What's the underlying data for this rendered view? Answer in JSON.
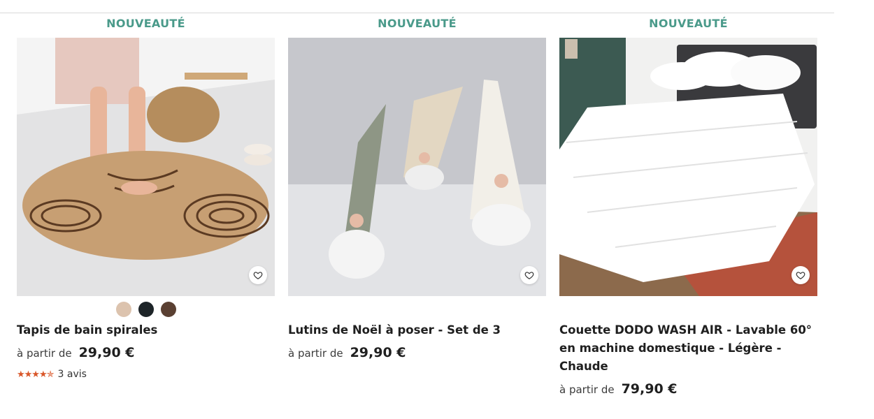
{
  "products": [
    {
      "badge": "NOUVEAUTÉ",
      "title": "Tapis de bain spirales",
      "from_label": "à partir de",
      "price": "29,90 €",
      "swatches": [
        "#dcc3ae",
        "#1d2428",
        "#5a4032"
      ],
      "rating": {
        "stars": 4.5,
        "star_glyphs": "★★★★✯",
        "reviews": "3 avis"
      },
      "wishlist_icon": "heart-outline-icon"
    },
    {
      "badge": "NOUVEAUTÉ",
      "title": "Lutins de Noël à poser - Set de 3",
      "from_label": "à partir de",
      "price": "29,90 €",
      "wishlist_icon": "heart-outline-icon"
    },
    {
      "badge": "NOUVEAUTÉ",
      "title": "Couette DODO WASH AIR - Lavable 60° en machine domestique - Légère - Chaude",
      "from_label": "à partir de",
      "price": "79,90 €",
      "wishlist_icon": "heart-outline-icon"
    }
  ],
  "colors": {
    "badge": "#4a9a8a",
    "star": "#d9572a"
  }
}
